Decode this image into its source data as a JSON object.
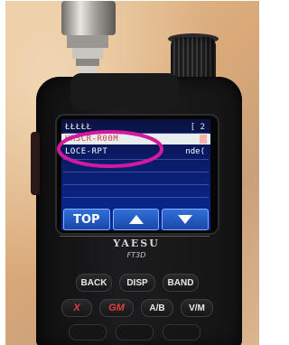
{
  "screen": {
    "rows": [
      {
        "text": "ŁŁŁŁŁ",
        "right": "[ 2",
        "state": "normal"
      },
      {
        "text": "HRSCR-R00M",
        "right": "",
        "state": "highlighted"
      },
      {
        "text": "LOCE-RPT",
        "right": "nde(",
        "state": "normal"
      }
    ],
    "softkeys": [
      {
        "label": "TOP",
        "icon": ""
      },
      {
        "label": "",
        "icon": "up-triangle-icon"
      },
      {
        "label": "",
        "icon": "down-triangle-icon"
      }
    ],
    "colors": {
      "background": "#0a2a9a",
      "highlight": "#e8eef0",
      "highlight_text": "#d03a3a",
      "softkey": "#1b46a8"
    }
  },
  "device": {
    "brand": "YAESU",
    "model": "FT3D"
  },
  "keypad": {
    "row1": [
      "BACK",
      "DISP",
      "BAND"
    ],
    "row2": [
      "X",
      "GM",
      "A/B",
      "V/M"
    ]
  },
  "annotation": {
    "shape": "ellipse",
    "color": "#d11aa0"
  }
}
